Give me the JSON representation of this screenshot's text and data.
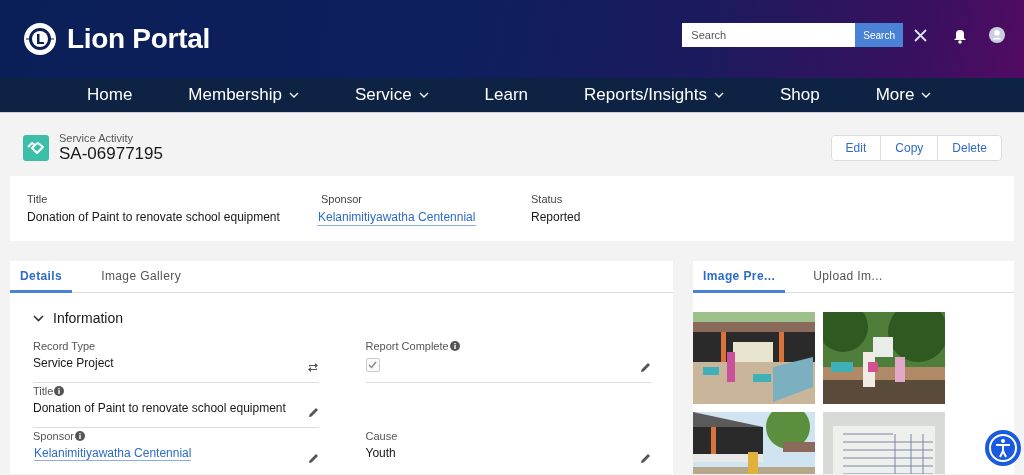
{
  "header": {
    "title": "Lion Portal",
    "search": {
      "placeholder": "Search",
      "button": "Search"
    }
  },
  "nav": [
    {
      "label": "Home",
      "dropdown": false
    },
    {
      "label": "Membership",
      "dropdown": true
    },
    {
      "label": "Service",
      "dropdown": true
    },
    {
      "label": "Learn",
      "dropdown": false
    },
    {
      "label": "Reports/Insights",
      "dropdown": true
    },
    {
      "label": "Shop",
      "dropdown": false
    },
    {
      "label": "More",
      "dropdown": true
    }
  ],
  "record": {
    "type": "Service Activity",
    "id": "SA-06977195",
    "actions": [
      "Edit",
      "Copy",
      "Delete"
    ]
  },
  "highlights": [
    {
      "label": "Title",
      "value": "Donation of Paint to renovate school equipment",
      "kind": "text"
    },
    {
      "label": "Sponsor",
      "value": "Kelanimitiyawatha Centennial",
      "kind": "link"
    },
    {
      "label": "Status",
      "value": "Reported",
      "kind": "text"
    }
  ],
  "details": {
    "tabs": [
      {
        "label": "Details",
        "selected": true
      },
      {
        "label": "Image Gallery",
        "selected": false
      }
    ],
    "section": {
      "title": "Information",
      "expanded": true
    },
    "rows": [
      [
        {
          "label": "Record Type",
          "value": "Service Project",
          "kind": "record_type",
          "info": false
        },
        {
          "label": "Report Complete",
          "kind": "checkbox",
          "checked": true,
          "info": true,
          "editable": true
        }
      ],
      [
        {
          "label": "Title",
          "value": "Donation of Paint to renovate school equipment",
          "kind": "text",
          "info": true,
          "editable": true
        }
      ],
      [
        {
          "label": "Sponsor",
          "value": "Kelanimitiyawatha Centennial",
          "kind": "link",
          "info": true,
          "editable": true
        },
        {
          "label": "Cause",
          "value": "Youth",
          "kind": "text",
          "info": false,
          "editable": true
        }
      ]
    ]
  },
  "gallery": {
    "tabs": [
      {
        "label": "Image Pre...",
        "selected": true
      },
      {
        "label": "Upload Im...",
        "selected": false
      }
    ]
  }
}
